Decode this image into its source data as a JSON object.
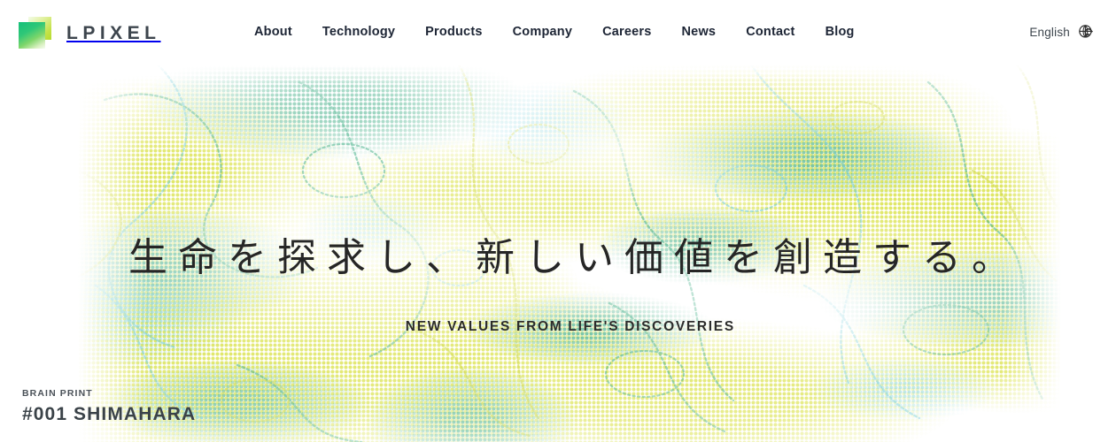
{
  "header": {
    "brand": {
      "wordmark": "LPIXEL",
      "logo_icon": "gradient-square-logo",
      "logo_colors": {
        "green": "#15c07a",
        "lime": "#b6dc2e",
        "pale": "#f6fcf2"
      }
    },
    "nav": [
      {
        "label": "About"
      },
      {
        "label": "Technology"
      },
      {
        "label": "Products"
      },
      {
        "label": "Company"
      },
      {
        "label": "Careers"
      },
      {
        "label": "News"
      },
      {
        "label": "Contact"
      },
      {
        "label": "Blog"
      }
    ],
    "language": {
      "label": "English",
      "icon": "globe-language-switch-icon"
    },
    "background_color": "#ffffff",
    "nav_text_color": "#1d2535"
  },
  "hero": {
    "headline": "生命を探求し、新しい価値を創造する。",
    "subheadline": "NEW VALUES FROM LIFE'S DISCOVERIES",
    "headline_color": "#262626",
    "caption": {
      "eyebrow": "BRAIN PRINT",
      "title": "#001 SHIMAHARA",
      "eyebrow_color": "#4a5158",
      "title_color": "#3a4248"
    },
    "background": {
      "style": "halftone-dot-contour-texture",
      "palette": [
        "#d8e03a",
        "#2aa578",
        "#5fc7d8",
        "#ffffff"
      ]
    }
  }
}
